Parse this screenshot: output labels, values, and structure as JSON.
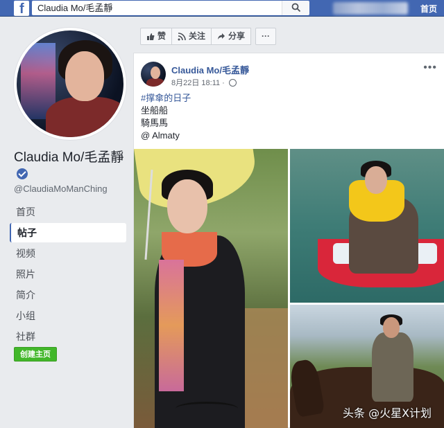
{
  "topbar": {
    "logo_letter": "f",
    "search_value": "Claudia Mo/毛孟靜",
    "home_label": "首页"
  },
  "profile": {
    "name": "Claudia Mo/毛孟靜",
    "handle": "@ClaudiaMoManChing",
    "verified": true
  },
  "nav": {
    "items": [
      {
        "label": "首页",
        "active": false
      },
      {
        "label": "帖子",
        "active": true
      },
      {
        "label": "视频",
        "active": false
      },
      {
        "label": "照片",
        "active": false
      },
      {
        "label": "简介",
        "active": false
      },
      {
        "label": "小组",
        "active": false
      },
      {
        "label": "社群",
        "active": false
      }
    ],
    "create_page_label": "创建主页"
  },
  "actions": {
    "like_label": "赞",
    "follow_label": "关注",
    "share_label": "分享",
    "more_label": "···"
  },
  "post": {
    "author": "Claudia Mo/毛孟靜",
    "time": "8月22日 18:11 ·",
    "more": "•••",
    "hashtag": "#撑傘的日子",
    "line2": "坐船船",
    "line3": "騎馬馬",
    "location": "@ Almaty"
  },
  "watermark": "头条 @火星X计划",
  "colors": {
    "facebook_blue": "#4267b2",
    "link_blue": "#365899",
    "create_green": "#42b72a"
  }
}
